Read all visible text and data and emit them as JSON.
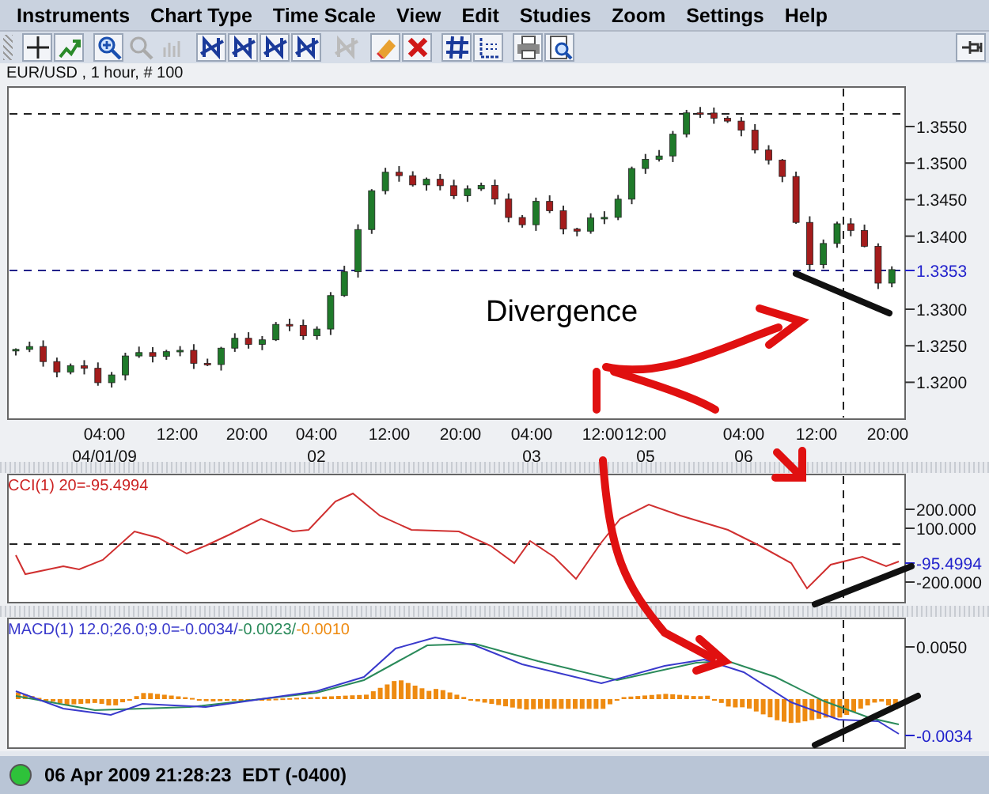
{
  "menu": [
    "Instruments",
    "Chart Type",
    "Time Scale",
    "View",
    "Edit",
    "Studies",
    "Zoom",
    "Settings",
    "Help"
  ],
  "toolbar": {
    "groups": [
      [
        {
          "kind": "crosshair",
          "disabled": false
        },
        {
          "kind": "add-study",
          "disabled": false
        }
      ],
      [
        {
          "kind": "zoom-in",
          "disabled": false
        },
        {
          "kind": "zoom-out",
          "disabled": true
        },
        {
          "kind": "bars",
          "disabled": true
        }
      ],
      [
        {
          "kind": "n-a",
          "disabled": false
        },
        {
          "kind": "n-b",
          "disabled": false
        },
        {
          "kind": "n-c",
          "disabled": false
        },
        {
          "kind": "n-d",
          "disabled": false
        }
      ],
      [
        {
          "kind": "n-e",
          "disabled": true
        }
      ],
      [
        {
          "kind": "eraser",
          "disabled": false
        },
        {
          "kind": "delete",
          "disabled": false
        }
      ],
      [
        {
          "kind": "grid",
          "disabled": false
        },
        {
          "kind": "line-style",
          "disabled": false
        }
      ],
      [
        {
          "kind": "print",
          "disabled": false
        },
        {
          "kind": "preview",
          "disabled": false
        }
      ]
    ],
    "pin": {
      "kind": "pin",
      "disabled": false
    }
  },
  "chart": {
    "title": "EUR/USD , 1 hour, # 100",
    "price_labels": [
      "1.3550",
      "1.3500",
      "1.3450",
      "1.3400",
      "1.3300",
      "1.3250",
      "1.3200"
    ],
    "current_price": "1.3353",
    "time_labels": [
      {
        "time": "04:00",
        "date": "04/01/09"
      },
      {
        "time": "12:00"
      },
      {
        "time": "20:00"
      },
      {
        "time": "04:00",
        "date": "02"
      },
      {
        "time": "12:00"
      },
      {
        "time": "20:00"
      },
      {
        "time": "04:00",
        "date": "03"
      },
      {
        "time": "12:00"
      },
      {
        "time": "12:00",
        "date": "05"
      },
      {
        "time": "04:00",
        "date": "06"
      },
      {
        "time": "12:00"
      },
      {
        "time": "20:00"
      }
    ]
  },
  "cci": {
    "label": "CCI(1) 20=-95.4994",
    "axis_labels": [
      "200.000",
      "100.000",
      "-200.000"
    ],
    "current_value": "-95.4994"
  },
  "macd": {
    "label_parts": [
      {
        "text": "MACD(1) 12.0;26.0;9.0=-0.0034/",
        "color": "#3a3acc"
      },
      {
        "text": "-0.0023/",
        "color": "#2a8a5a"
      },
      {
        "text": "-0.0010",
        "color": "#ee8a10"
      }
    ],
    "axis_labels": [
      "0.0050"
    ],
    "current_value": "-0.0034"
  },
  "annotation": {
    "text": "Divergence"
  },
  "status": {
    "connected": true,
    "text": "06 Apr 2009 21:28:23  EDT (-0400)"
  }
}
